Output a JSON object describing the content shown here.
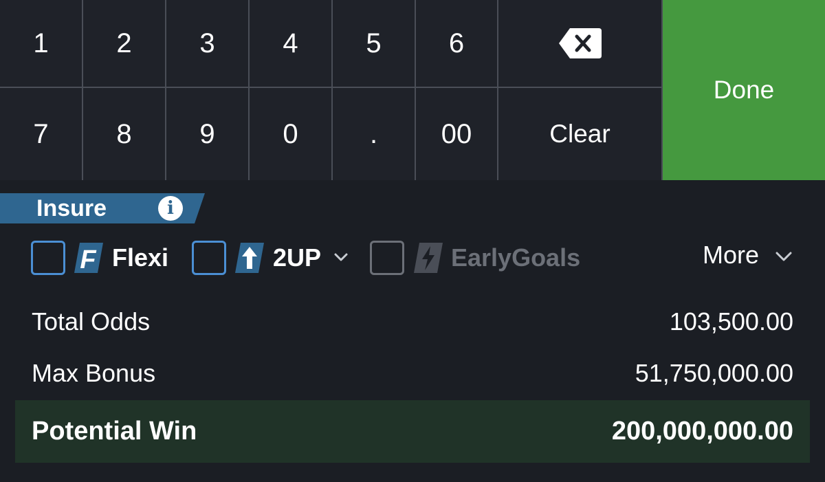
{
  "keypad": {
    "keys_row1": [
      "1",
      "2",
      "3",
      "4",
      "5",
      "6"
    ],
    "keys_row2": [
      "7",
      "8",
      "9",
      "0",
      ".",
      "00"
    ],
    "backspace_icon": "backspace-icon",
    "clear_label": "Clear",
    "done_label": "Done",
    "done_color": "#45993f"
  },
  "insure": {
    "label": "Insure",
    "info_glyph": "i",
    "banner_color": "#2f6690"
  },
  "options": {
    "flexi": {
      "label": "Flexi",
      "badge_glyph": "F",
      "checked": false,
      "enabled": true
    },
    "twoup": {
      "label": "2UP",
      "checked": false,
      "enabled": true,
      "icon": "arrow-up-icon"
    },
    "earlygoals": {
      "label": "EarlyGoals",
      "checked": false,
      "enabled": false,
      "icon": "lightning-icon"
    },
    "more_label": "More"
  },
  "summary": {
    "total_odds_label": "Total Odds",
    "total_odds_value": "103,500.00",
    "max_bonus_label": "Max Bonus",
    "max_bonus_value": "51,750,000.00",
    "potential_win_label": "Potential Win",
    "potential_win_value": "200,000,000.00"
  },
  "colors": {
    "background": "#1b1e24",
    "key_background": "#1f2229",
    "checkbox_border": "#4b8fd4",
    "win_background": "#203328"
  }
}
